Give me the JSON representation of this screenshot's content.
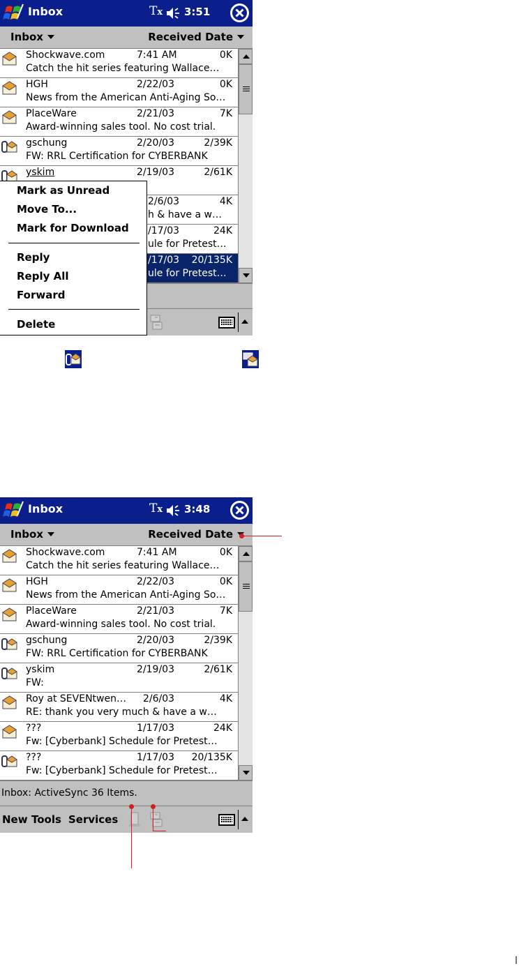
{
  "screens": [
    {
      "title": "Inbox",
      "clock": "3:51",
      "folder": "Inbox",
      "sort": "Received Date",
      "messages": [
        {
          "sender": "Shockwave.com",
          "date": "7:41 AM",
          "size": "0K",
          "subject": "Catch the hit series featuring Wallace…",
          "icon": "envelope-icon"
        },
        {
          "sender": "HGH",
          "date": "2/22/03",
          "size": "0K",
          "subject": "News from the American Anti-Aging So…",
          "icon": "envelope-icon"
        },
        {
          "sender": "PlaceWare",
          "date": "2/21/03",
          "size": "7K",
          "subject": "Award-winning sales tool. No cost trial.",
          "icon": "envelope-icon"
        },
        {
          "sender": "gschung",
          "date": "2/20/03",
          "size": "2/39K",
          "subject": "FW: RRL Certification for CYBERBANK",
          "icon": "attachment-envelope-icon"
        },
        {
          "sender": "yskim",
          "date": "2/19/03",
          "size": "2/61K",
          "subject": "",
          "icon": "attachment-envelope-icon"
        },
        {
          "sender": "",
          "date": "2/6/03",
          "size": "4K",
          "subject": "h & have a w…",
          "icon": ""
        },
        {
          "sender": "",
          "date": "/17/03",
          "size": "24K",
          "subject": "ule for Pretest…",
          "icon": ""
        },
        {
          "sender": "",
          "date": "/17/03",
          "size": "20/135K",
          "subject": "ule for Pretest…",
          "icon": "",
          "selected": true
        }
      ],
      "context_menu": {
        "group1": [
          "Mark as Unread",
          "Move To...",
          "Mark for Download"
        ],
        "group2": [
          "Reply",
          "Reply All",
          "Forward"
        ],
        "group3": [
          "Delete"
        ]
      }
    },
    {
      "title": "Inbox",
      "clock": "3:48",
      "folder": "Inbox",
      "sort": "Received Date",
      "messages": [
        {
          "sender": "Shockwave.com",
          "date": "7:41 AM",
          "size": "0K",
          "subject": "Catch the hit series featuring Wallace…",
          "icon": "envelope-icon"
        },
        {
          "sender": "HGH",
          "date": "2/22/03",
          "size": "0K",
          "subject": "News from the American Anti-Aging So…",
          "icon": "envelope-icon"
        },
        {
          "sender": "PlaceWare",
          "date": "2/21/03",
          "size": "7K",
          "subject": "Award-winning sales tool. No cost trial.",
          "icon": "envelope-icon"
        },
        {
          "sender": "gschung",
          "date": "2/20/03",
          "size": "2/39K",
          "subject": "FW: RRL Certification for CYBERBANK",
          "icon": "attachment-envelope-icon"
        },
        {
          "sender": "yskim",
          "date": "2/19/03",
          "size": "2/61K",
          "subject": "FW:",
          "icon": "attachment-envelope-icon"
        },
        {
          "sender": "Roy at SEVENtwen…",
          "date": "2/6/03",
          "size": "4K",
          "subject": "RE: thank you very much & have a w…",
          "icon": "envelope-icon"
        },
        {
          "sender": "???",
          "date": "1/17/03",
          "size": "24K",
          "subject": "Fw: [Cyberbank] Schedule for Pretest…",
          "icon": "envelope-icon"
        },
        {
          "sender": "???",
          "date": "1/17/03",
          "size": "20/135K",
          "subject": "Fw: [Cyberbank] Schedule for Pretest…",
          "icon": "attachment-envelope-icon"
        }
      ],
      "status": "Inbox: ActiveSync  36 Items.",
      "menu": {
        "new": "New",
        "tools": "Tools",
        "services": "Services"
      }
    }
  ],
  "legend_icons": [
    "attachment-envelope-icon",
    "download-envelope-icon"
  ],
  "colors": {
    "titlebar": "#0a1e8c",
    "selection": "#0a246a",
    "chrome": "#c0c0c0",
    "callout": "#d02020",
    "envelope": "#e8a030"
  }
}
